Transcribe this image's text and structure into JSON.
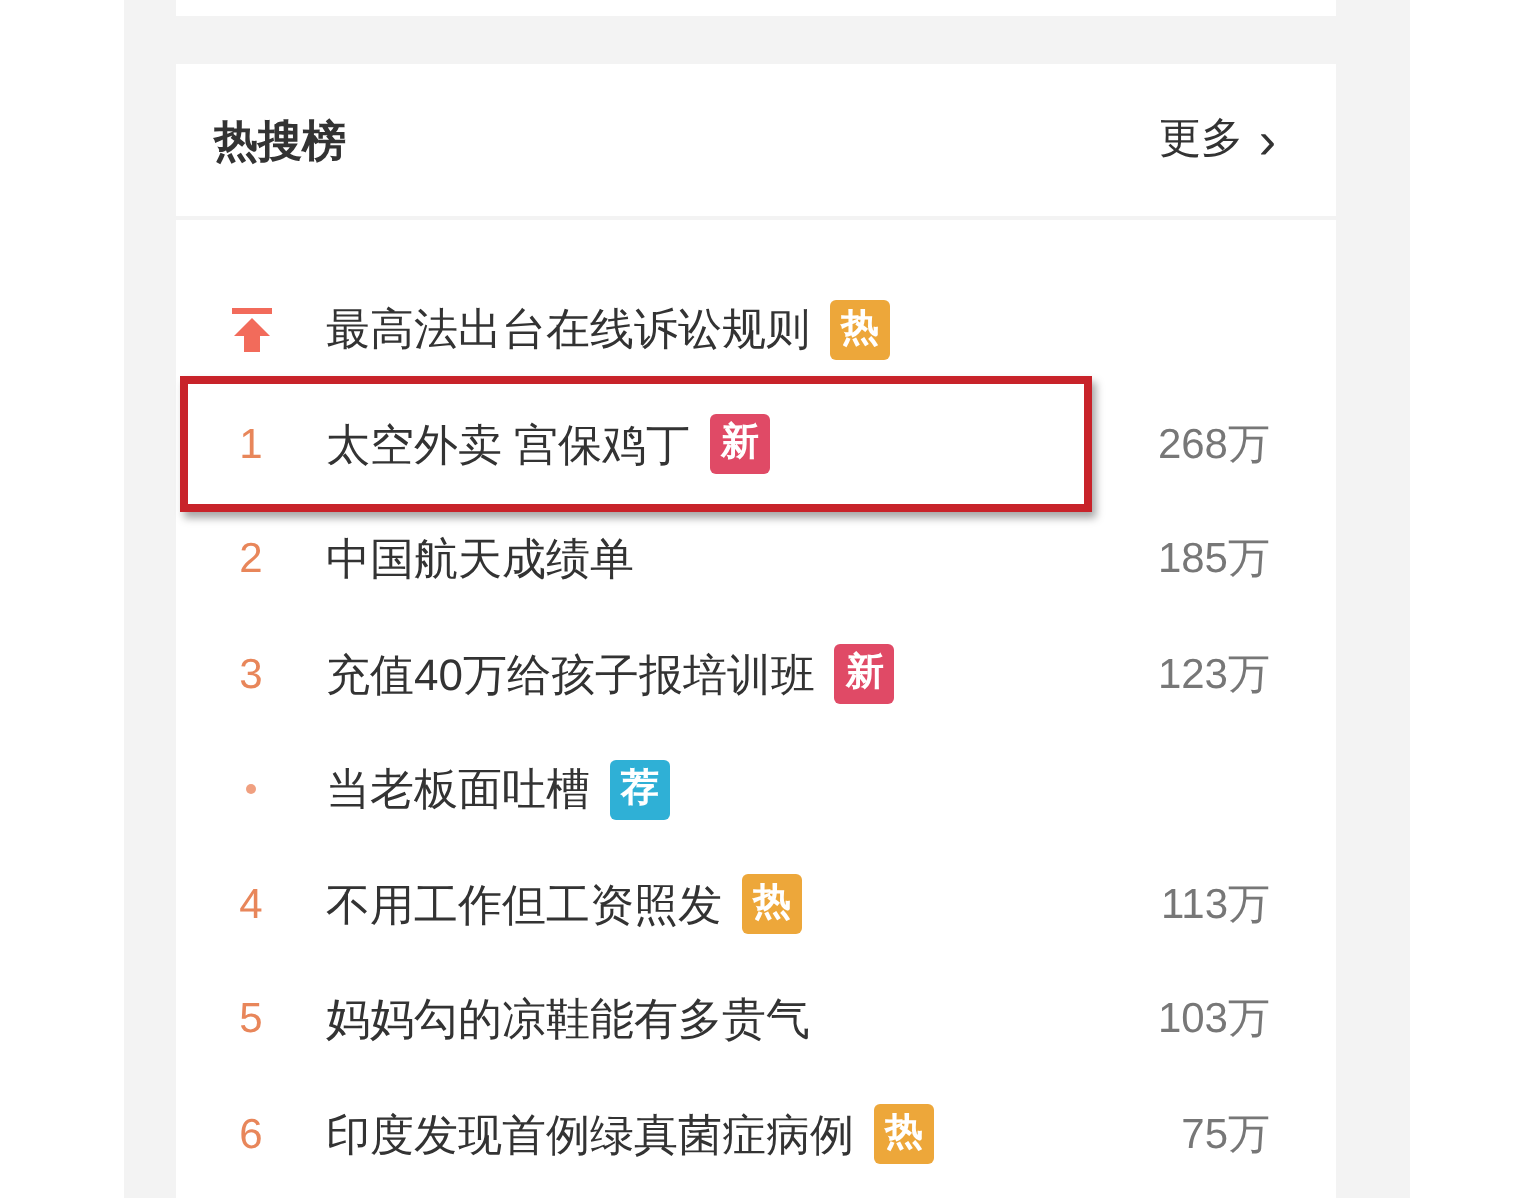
{
  "header": {
    "title": "热搜榜",
    "more_link": "更多",
    "more_arrow": "›"
  },
  "items": [
    {
      "kind": "pinned",
      "title": "最高法出台在线诉讼规则",
      "badge": {
        "text": "热",
        "color": "#eda73a"
      },
      "highlighted": false
    },
    {
      "kind": "ranked",
      "rank": "1",
      "title": "太空外卖 宫保鸡丁",
      "badge": {
        "text": "新",
        "color": "#e04a66"
      },
      "count": "268万",
      "highlighted": true
    },
    {
      "kind": "ranked",
      "rank": "2",
      "title": "中国航天成绩单",
      "count": "185万",
      "highlighted": false
    },
    {
      "kind": "ranked",
      "rank": "3",
      "title": "充值40万给孩子报培训班",
      "badge": {
        "text": "新",
        "color": "#e04a66"
      },
      "count": "123万",
      "highlighted": false
    },
    {
      "kind": "recommended",
      "title": "当老板面吐槽",
      "badge": {
        "text": "荐",
        "color": "#2fb0d6"
      },
      "highlighted": false
    },
    {
      "kind": "ranked",
      "rank": "4",
      "title": "不用工作但工资照发",
      "badge": {
        "text": "热",
        "color": "#eda73a"
      },
      "count": "113万",
      "highlighted": false
    },
    {
      "kind": "ranked",
      "rank": "5",
      "title": "妈妈勾的凉鞋能有多贵气",
      "count": "103万",
      "highlighted": false
    },
    {
      "kind": "ranked",
      "rank": "6",
      "title": "印度发现首例绿真菌症病例",
      "badge": {
        "text": "热",
        "color": "#eda73a"
      },
      "count": "75万",
      "highlighted": false
    }
  ]
}
